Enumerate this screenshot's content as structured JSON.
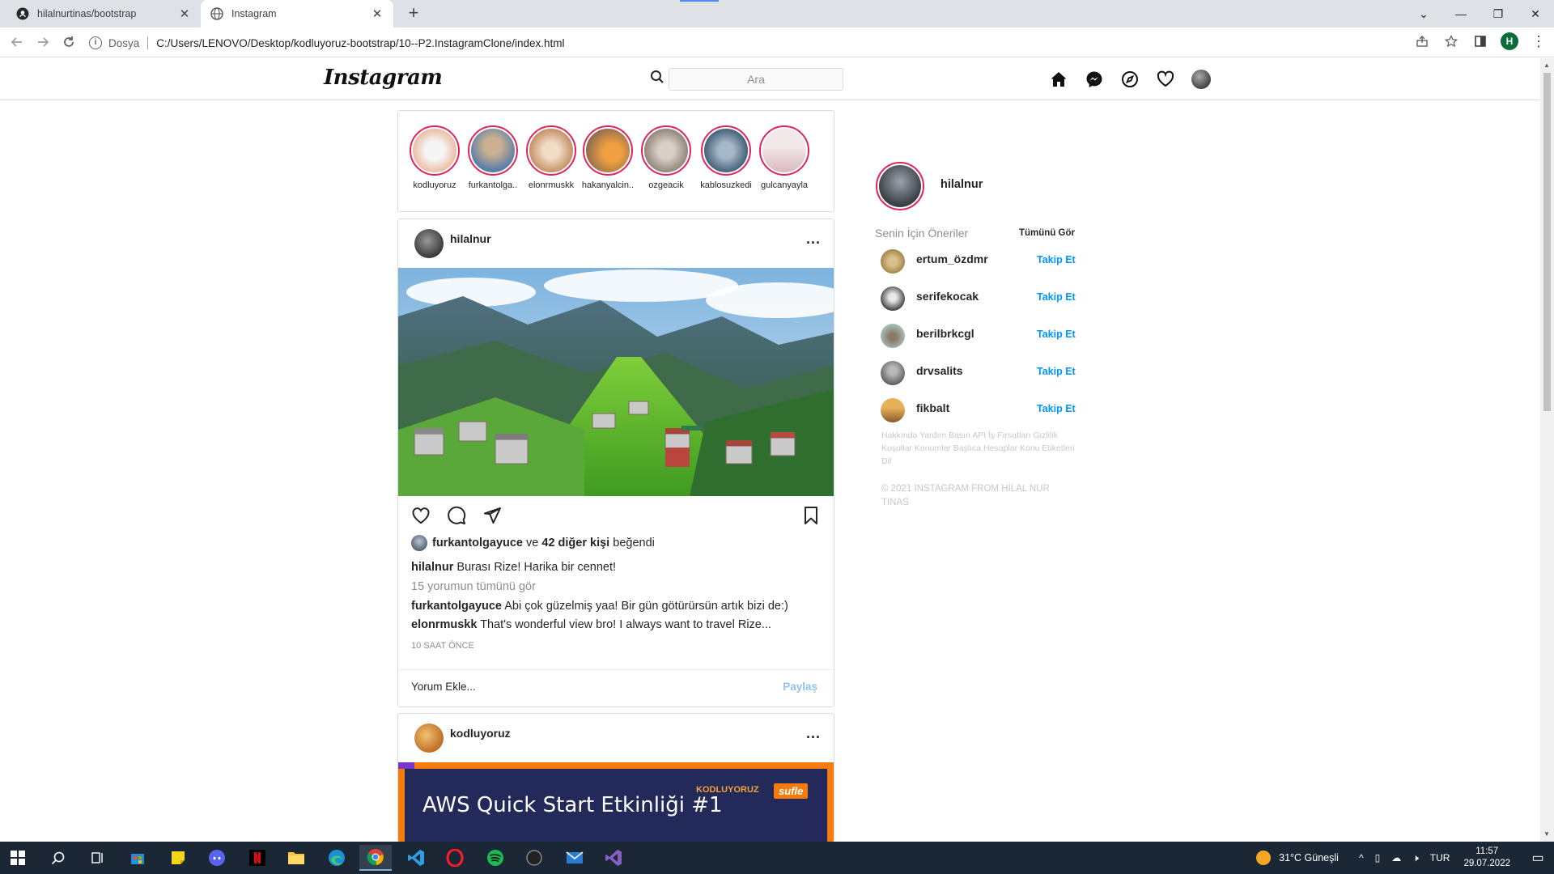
{
  "browser": {
    "tabs": [
      {
        "title": "hilalnurtinas/bootstrap",
        "active": false
      },
      {
        "title": "Instagram",
        "active": true
      }
    ],
    "address_scheme": "Dosya",
    "address_url": "C:/Users/LENOVO/Desktop/kodluyoruz-bootstrap/10--P2.InstagramClone/index.html",
    "profile_initial": "H"
  },
  "header": {
    "logo": "Instagram",
    "search_placeholder": "Ara",
    "nav_icons": [
      "home-icon",
      "messenger-icon",
      "explore-icon",
      "heart-icon",
      "profile-avatar"
    ]
  },
  "stories": [
    {
      "name": "kodluyoruz"
    },
    {
      "name": "furkantolga.."
    },
    {
      "name": "elonrmuskk"
    },
    {
      "name": "hakanyalcin.."
    },
    {
      "name": "ozgeacik"
    },
    {
      "name": "kablosuzkedi"
    },
    {
      "name": "gulcanyayla"
    }
  ],
  "post": {
    "username": "hilalnur",
    "more": "...",
    "likes": {
      "user": "furkantolgayuce",
      "connector": "ve",
      "others": "42 diğer kişi",
      "suffix": "beğendi"
    },
    "caption": {
      "user": "hilalnur",
      "text": "Burası Rize! Harika bir cennet!"
    },
    "view_all_comments": "15 yorumun tümünü gör",
    "comments": [
      {
        "user": "furkantolgayuce",
        "text": "Abi çok güzelmiş yaa! Bir gün götürürsün artık bizi de:)"
      },
      {
        "user": "elonrmuskk",
        "text": "That's wonderful view bro! I always want to travel Rize..."
      }
    ],
    "time": "10 SAAT ÖNCE",
    "comment_placeholder": "Yorum Ekle...",
    "share_label": "Paylaş"
  },
  "post2": {
    "username": "kodluyoruz",
    "more": "...",
    "banner_title": "AWS Quick Start Etkinliği #1",
    "banner_brand": "KODLUYORUZ",
    "banner_tag": "sufle"
  },
  "sidebar": {
    "me": "hilalnur",
    "suggestions_title": "Senin İçin Öneriler",
    "see_all": "Tümünü Gör",
    "follow_label": "Takip Et",
    "suggestions": [
      {
        "name": "ertum_özdmr"
      },
      {
        "name": "serifekocak"
      },
      {
        "name": "berilbrkcgl"
      },
      {
        "name": "drvsalits"
      },
      {
        "name": "fikbalt"
      }
    ],
    "footer_links": "Hakkında Yardım Basın API İş Fırsatları Gizlilik Koşullar Konumlar Başlıca Hesaplar Konu Etiketleri Dil",
    "copyright": "© 2021 INSTAGRAM FROM HİLAL NUR TINAS"
  },
  "taskbar": {
    "weather": "31°C  Güneşli",
    "language": "TUR",
    "time": "11:57",
    "date": "29.07.2022"
  },
  "colors": {
    "story_ring": "#e0245e",
    "follow_blue": "#0095f6",
    "share_disabled": "#8fc3ef",
    "taskbar": "#1b2735"
  }
}
